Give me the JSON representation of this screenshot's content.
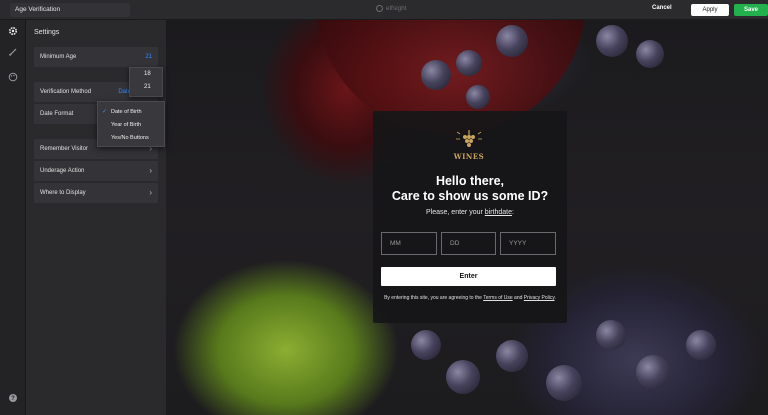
{
  "topbar": {
    "title": "Age Verification",
    "brand": "elfsight",
    "cancel": "Cancel",
    "apply": "Apply",
    "save": "Save"
  },
  "rail": {
    "icons": [
      "gear-icon",
      "brush-icon",
      "palette-icon",
      "help-icon"
    ]
  },
  "panel": {
    "title": "Settings",
    "rows": [
      {
        "label": "Minimum Age",
        "value": "21"
      },
      {
        "label": "Verification Method",
        "value": "Date o"
      },
      {
        "label": "Date Format"
      },
      {
        "label": "Remember Visitor"
      },
      {
        "label": "Underage Action"
      },
      {
        "label": "Where to Display"
      }
    ],
    "age_dropdown": [
      "18",
      "21"
    ],
    "format_dropdown": [
      "Date of Birth",
      "Year of Birth",
      "Yes/No Buttons"
    ]
  },
  "popup": {
    "logo_text": "WINES",
    "headline_1": "Hello there,",
    "headline_2": "Care to show us some ID?",
    "sub_prefix": "Please, enter your ",
    "sub_link": "birthdate",
    "sub_suffix": ":",
    "mm_placeholder": "MM",
    "dd_placeholder": "DD",
    "yyyy_placeholder": "YYYY",
    "enter": "Enter",
    "terms_1": "By entering this site, you are agreeing to the ",
    "terms_link1": "Terms of Use",
    "terms_2": " and ",
    "terms_link2": "Privacy Policy",
    "terms_3": "."
  },
  "colors": {
    "accent": "#2e8bff",
    "save": "#22b14c",
    "logo": "#c9a45c"
  }
}
